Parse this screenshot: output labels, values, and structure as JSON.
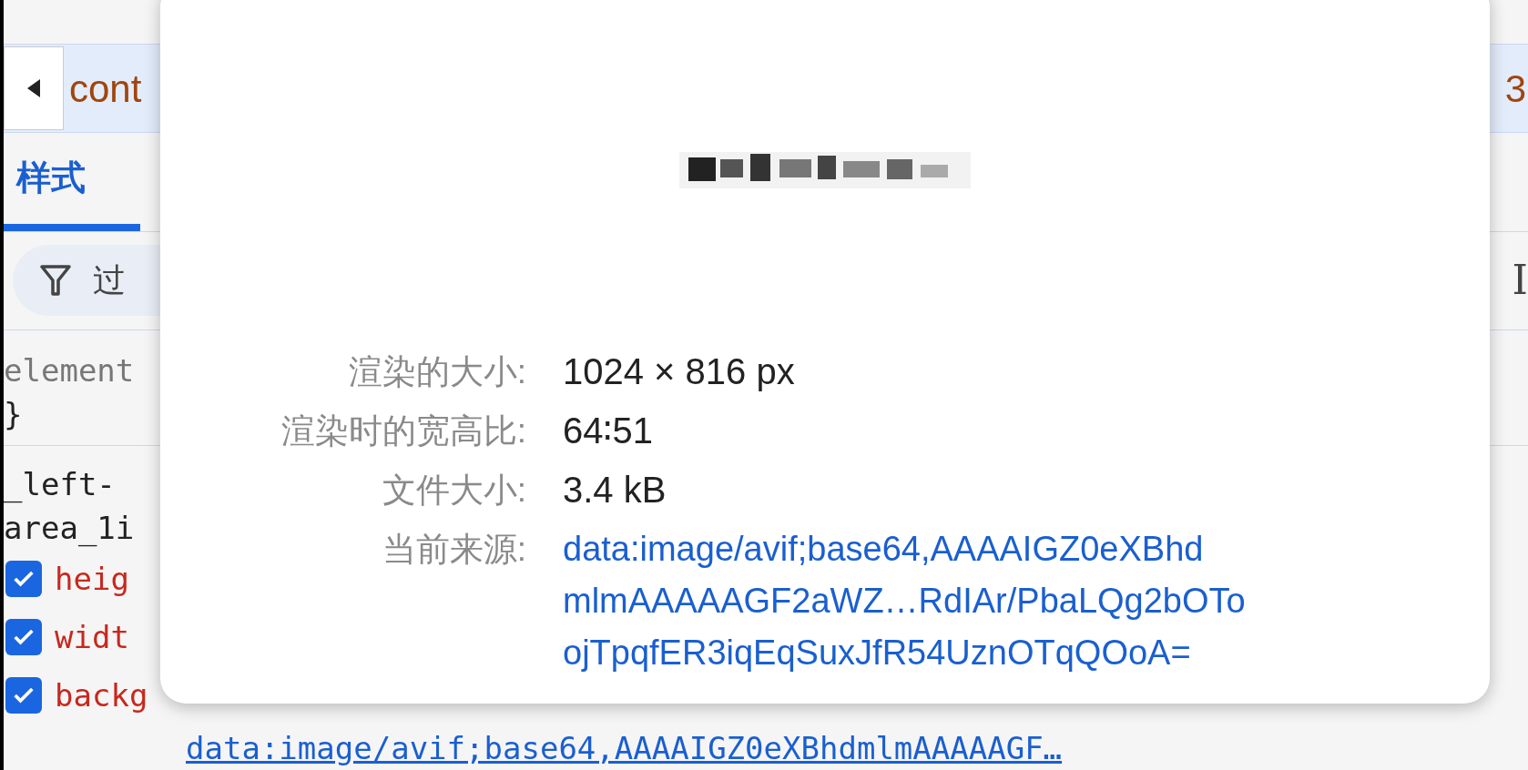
{
  "devtools": {
    "breadcrumb_text": "cont",
    "right_edge_texts": [
      "3",
      "I"
    ],
    "tabs": [
      {
        "label": "样式",
        "selected": true
      }
    ],
    "filter": {
      "placeholder": "过"
    },
    "rules": [
      {
        "kind": "selector",
        "text": "element"
      },
      {
        "kind": "brace",
        "text": "}"
      },
      {
        "kind": "selector_dark",
        "text": "_left-"
      },
      {
        "kind": "selector_dark",
        "text": "area_1i"
      }
    ],
    "properties": [
      {
        "name": "heig",
        "checked": true
      },
      {
        "name": "widt",
        "checked": true
      },
      {
        "name": "backg",
        "checked": true
      }
    ],
    "url_link": "data:image/avif;base64,AAAAIGZ0eXBhdmlmAAAAAGF…"
  },
  "image_popup": {
    "rows": [
      {
        "kind": "text",
        "label": "渲染的大小:",
        "value": "1024 × 816 px"
      },
      {
        "kind": "text",
        "label": "渲染时的宽高比:",
        "value": "64∶51"
      },
      {
        "kind": "text",
        "label": "文件大小:",
        "value": "3.4 kB"
      },
      {
        "kind": "link",
        "label": "当前来源:",
        "lines": [
          "data:image/avif;base64,AAAAIGZ0eXBhd",
          "mlmAAAAAGF2aWZ…RdIAr/PbaLQg2bOTo",
          "ojTpqfER3iqEqSuxJfR54UznOTqQOoA="
        ]
      }
    ]
  }
}
